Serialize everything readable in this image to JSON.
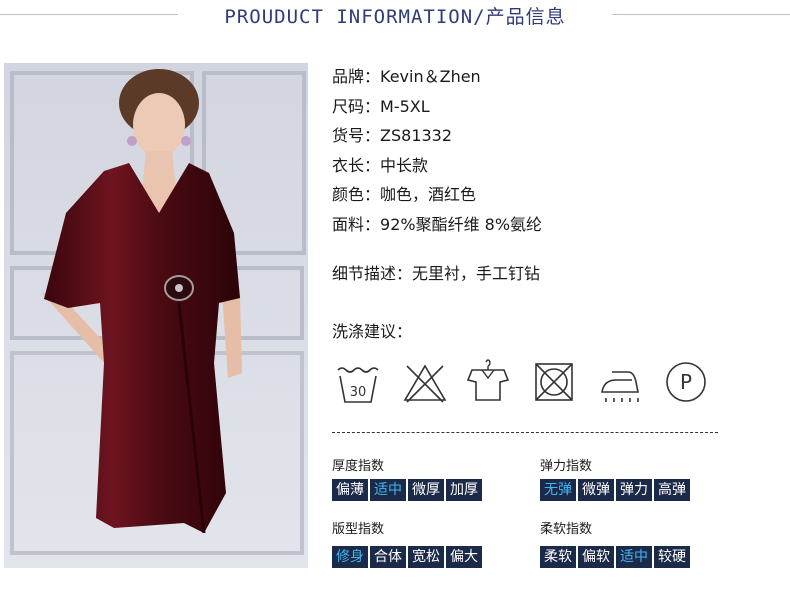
{
  "header": {
    "title": "PROUDUCT INFORMATION/产品信息"
  },
  "product": {
    "image_alt": "burgundy velvet midi dress with V-neck and beaded waist detail",
    "specs": [
      {
        "label": "品牌：",
        "value": "Kevin＆Zhen"
      },
      {
        "label": "尺码：",
        "value": "M-5XL"
      },
      {
        "label": "货号：",
        "value": "ZS81332"
      },
      {
        "label": "衣长：",
        "value": "中长款"
      },
      {
        "label": "颜色：",
        "value": "咖色，酒红色"
      },
      {
        "label": "面料：",
        "value": "92%聚酯纤维 8%氨纶"
      }
    ],
    "detail": {
      "label": "细节描述：",
      "value": "无里衬，手工钉钻"
    }
  },
  "care": {
    "label": "洗涤建议：",
    "icons": [
      {
        "name": "wash-30-icon",
        "text": "30"
      },
      {
        "name": "no-bleach-icon"
      },
      {
        "name": "hang-dry-icon"
      },
      {
        "name": "no-tumble-dry-icon"
      },
      {
        "name": "iron-icon"
      },
      {
        "name": "dry-clean-p-icon",
        "text": "P"
      }
    ]
  },
  "indices": [
    {
      "title": "厚度指数",
      "options": [
        "偏薄",
        "适中",
        "微厚",
        "加厚"
      ],
      "active": 1
    },
    {
      "title": "弹力指数",
      "options": [
        "无弹",
        "微弹",
        "弹力",
        "高弹"
      ],
      "active": 0
    },
    {
      "title": "版型指数",
      "options": [
        "修身",
        "合体",
        "宽松",
        "偏大"
      ],
      "active": 0
    },
    {
      "title": "柔软指数",
      "options": [
        "柔软",
        "偏软",
        "适中",
        "较硬"
      ],
      "active": 2
    }
  ],
  "colors": {
    "title": "#2f3c7a",
    "cell_bg": "#1c2a4a",
    "cell_active_text": "#3fb7f0",
    "dress": "#5a0d16"
  }
}
